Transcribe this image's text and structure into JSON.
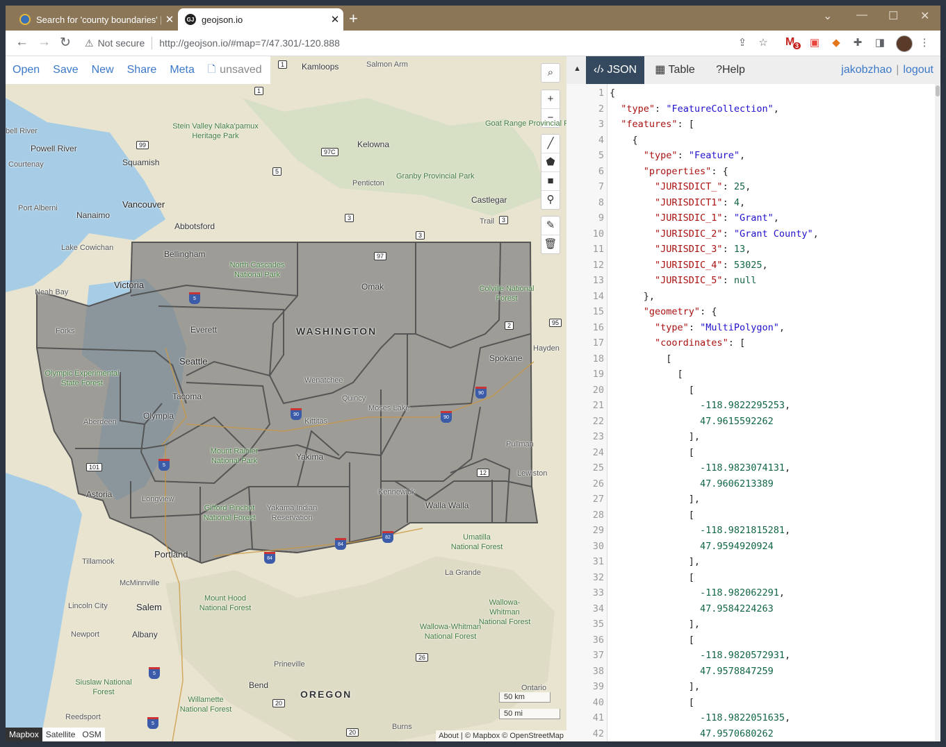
{
  "browser": {
    "tabs": [
      {
        "title": "Search for 'county boundaries' | V",
        "favicon": "globe-icon",
        "active": false
      },
      {
        "title": "geojson.io",
        "favicon": "GJ",
        "active": true
      }
    ],
    "security_label": "Not secure",
    "url": "http://geojson.io/#map=7/47.301/-120.888",
    "gmail_badge": "3",
    "frame_color": "#8b7658"
  },
  "app": {
    "menu": [
      "Open",
      "Save",
      "New",
      "Share",
      "Meta"
    ],
    "unsaved_label": "unsaved",
    "panel_tabs": [
      {
        "label": "JSON",
        "icon": "code-icon"
      },
      {
        "label": "Table",
        "icon": "table-icon"
      },
      {
        "label": "Help",
        "icon": "help-icon"
      }
    ],
    "user": "jakobzhao",
    "logout": "logout",
    "accent": "#34495e"
  },
  "map": {
    "labels": {
      "kamloops": "Kamloops",
      "salmon_arm": "Salmon Arm",
      "goat_range": "Goat Range Provincial Park",
      "stein": "Stein Valley Nlaka'pamux Heritage Park",
      "powell_river": "Powell River",
      "squamish": "Squamish",
      "bell_river": "bell River",
      "courtenay": "Courtenay",
      "kelowna": "Kelowna",
      "granby": "Granby Provincial Park",
      "penticton": "Penticton",
      "castlegar": "Castlegar",
      "port_alberni": "Port Alberni",
      "nanaimo": "Nanaimo",
      "vancouver": "Vancouver",
      "abbotsford": "Abbotsford",
      "trail": "Trail",
      "lake_cowichan": "Lake Cowichan",
      "bellingham": "Bellingham",
      "north_cascades": "North Cascades National Park",
      "victoria": "Victoria",
      "neah_bay": "Neah Bay",
      "omak": "Omak",
      "colville": "Colville National Forest",
      "forks": "Forks",
      "everett": "Everett",
      "washington": "WASHINGTON",
      "hayden": "Hayden",
      "seattle": "Seattle",
      "spokane": "Spokane",
      "olympic": "Olympic Experimental State Forest",
      "wenatchee": "Wenatchee",
      "quincy": "Quincy",
      "moses_lake": "Moses Lake",
      "tacoma": "Tacoma",
      "olympia": "Olympia",
      "aberdeen": "Aberdeen",
      "kittitas": "Kittitas",
      "pullman": "Pullman",
      "mount_rainier": "Mount Rainier National Park",
      "yakima": "Yakima",
      "lewiston": "Lewiston",
      "astoria": "Astoria",
      "longview": "Longview",
      "gifford": "Gifford Pinchot National Forest",
      "yakama": "Yakama Indian Reservation",
      "kennewick": "Kennewick",
      "walla_walla": "Walla Walla",
      "umatilla": "Umatilla National Forest",
      "portland": "Portland",
      "tillamook": "Tillamook",
      "la_grande": "La Grande",
      "mcminnville": "McMinnville",
      "mount_hood": "Mount Hood National Forest",
      "wallowa1": "Wallowa-Whitman National Forest",
      "lincoln_city": "Lincoln City",
      "salem": "Salem",
      "newport": "Newport",
      "albany": "Albany",
      "wallowa2": "Wallowa-Whitman National Forest",
      "prineville": "Prineville",
      "siuslaw": "Siuslaw National Forest",
      "bend": "Bend",
      "oregon": "OREGON",
      "ontario": "Ontario",
      "willamette": "Willamette National Forest",
      "reedsport": "Reedsport",
      "burns": "Burns"
    },
    "shields": [
      "1",
      "1",
      "99",
      "97C",
      "5",
      "3",
      "3",
      "3",
      "97",
      "95",
      "2",
      "12",
      "101",
      "20",
      "26",
      "20",
      "20"
    ],
    "interstates": [
      "5",
      "90",
      "90",
      "90",
      "5",
      "82",
      "84",
      "84",
      "5",
      "5"
    ],
    "scale": {
      "km": "50 km",
      "mi": "50 mi"
    },
    "layers": [
      "Mapbox",
      "Satellite",
      "OSM"
    ],
    "active_layer": "Mapbox",
    "attribution": {
      "about": "About",
      "rest": "| © Mapbox © OpenStreetMap"
    }
  },
  "json_lines": [
    "{",
    "  \"type\": \"FeatureCollection\",",
    "  \"features\": [",
    "    {",
    "      \"type\": \"Feature\",",
    "      \"properties\": {",
    "        \"JURISDICT_\": 25,",
    "        \"JURISDICT1\": 4,",
    "        \"JURISDIC_1\": \"Grant\",",
    "        \"JURISDIC_2\": \"Grant County\",",
    "        \"JURISDIC_3\": 13,",
    "        \"JURISDIC_4\": 53025,",
    "        \"JURISDIC_5\": null",
    "      },",
    "      \"geometry\": {",
    "        \"type\": \"MultiPolygon\",",
    "        \"coordinates\": [",
    "          [",
    "            [",
    "              [",
    "                -118.9822295253,",
    "                47.9615592262",
    "              ],",
    "              [",
    "                -118.9823074131,",
    "                47.9606213389",
    "              ],",
    "              [",
    "                -118.9821815281,",
    "                47.9594920924",
    "              ],",
    "              [",
    "                -118.982062291,",
    "                47.9584224263",
    "              ],",
    "              [",
    "                -118.9820572931,",
    "                47.9578847259",
    "              ],",
    "              [",
    "                -118.9822051635,",
    "                47.9570680262"
  ]
}
